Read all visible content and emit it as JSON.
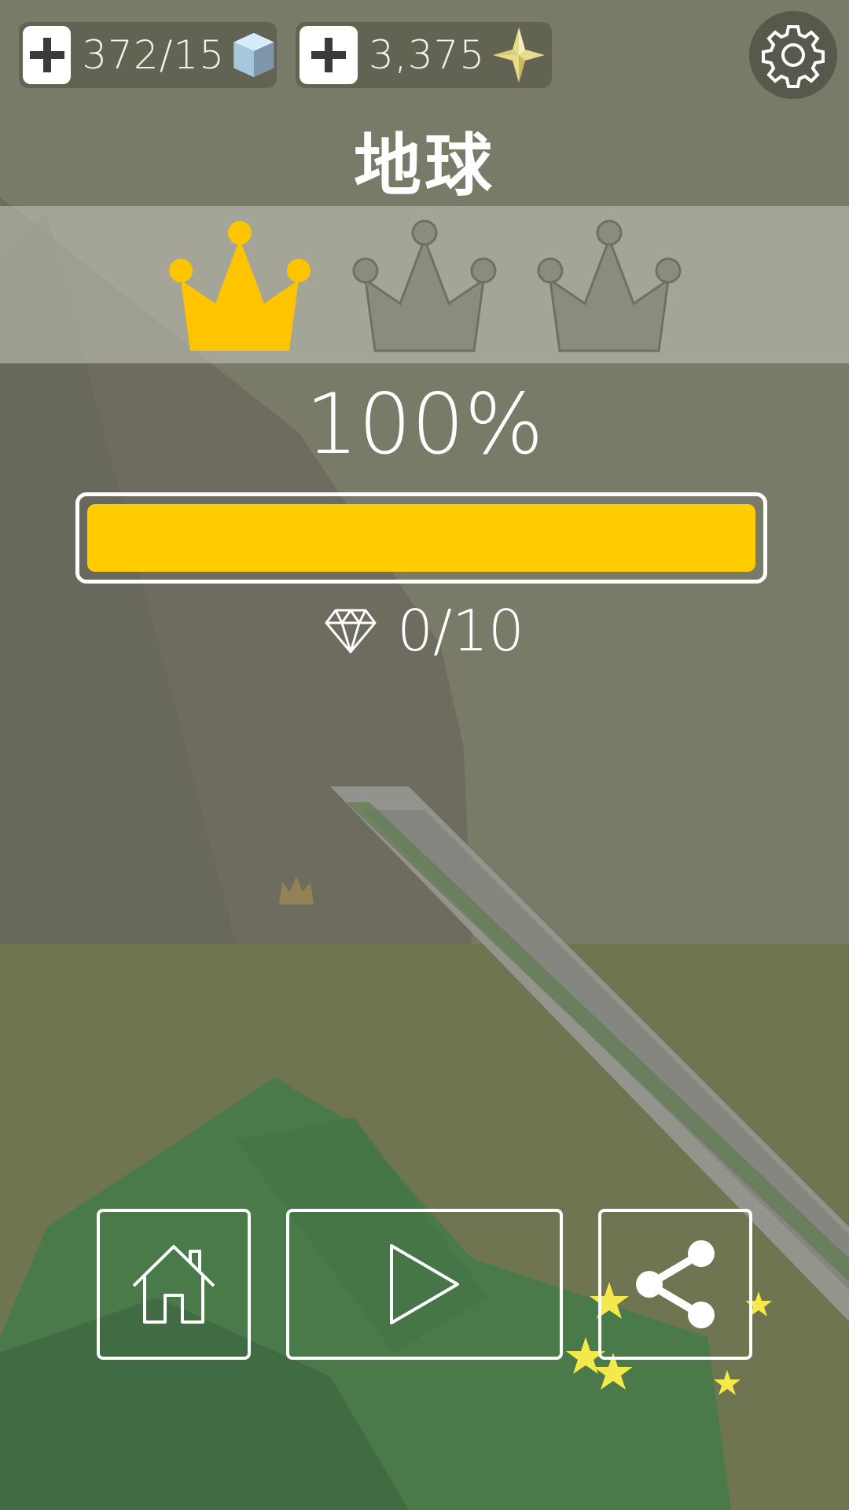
{
  "hud": {
    "cubes": {
      "value": "372/15",
      "icon": "ice-cube-icon"
    },
    "stars": {
      "value": "3,375",
      "icon": "gold-star-icon"
    },
    "settings_icon": "gear-icon"
  },
  "level": {
    "title": "地球",
    "crowns_earned": 1,
    "crowns_total": 3,
    "percent_label": "100%",
    "progress": 1.0,
    "gems": "0/10",
    "gem_icon": "diamond-icon"
  },
  "actions": {
    "home_icon": "house-icon",
    "play_icon": "play-triangle-icon",
    "share_icon": "share-icon"
  },
  "colors": {
    "accent": "#ffcc00",
    "crown_inactive": "#8b8b80",
    "white": "#ffffff"
  }
}
